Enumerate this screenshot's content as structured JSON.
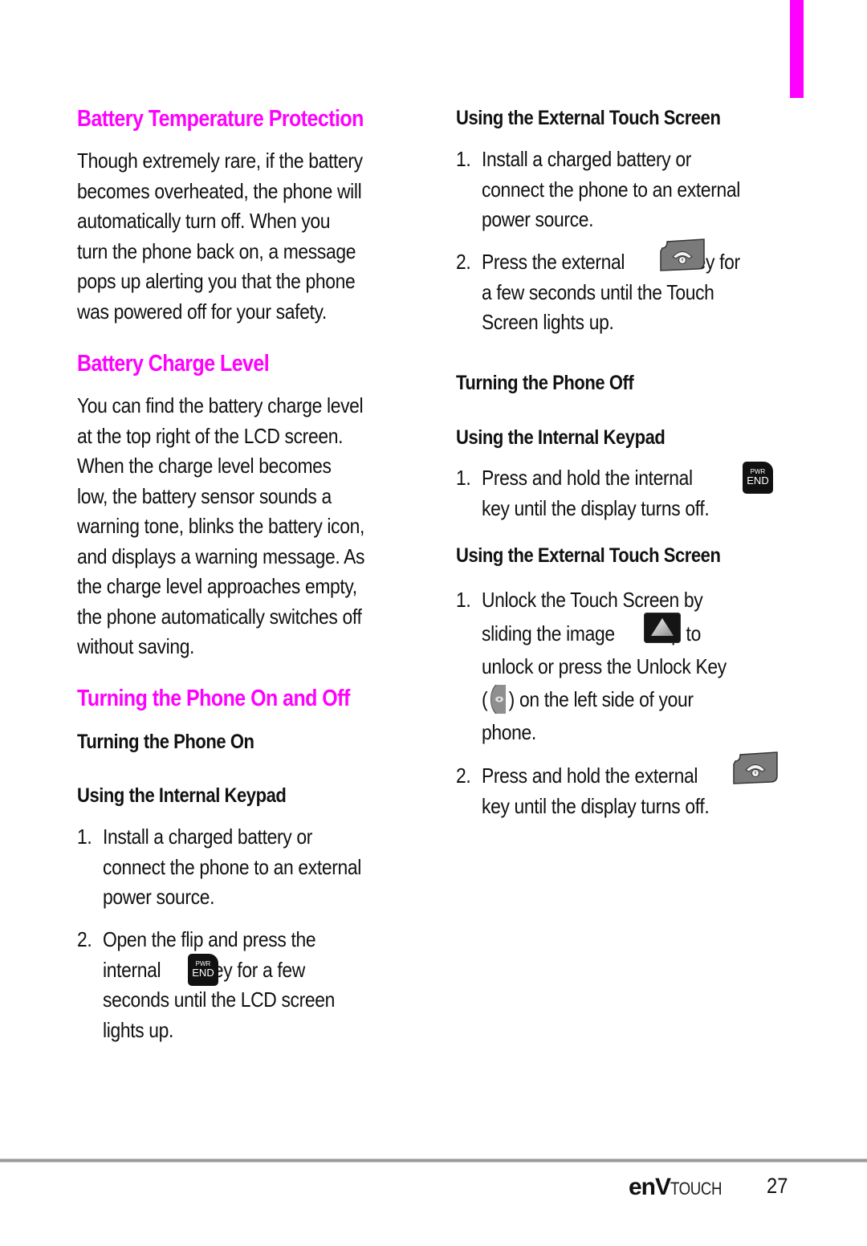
{
  "colors": {
    "accent": "#FF00FF",
    "text": "#111111",
    "rule": "#999999"
  },
  "left": {
    "battery_temp": {
      "heading": "Battery Temperature Protection",
      "lines": [
        "Though extremely rare, if the battery",
        "becomes overheated, the phone will",
        "automatically turn off. When you",
        "turn the phone back on, a message",
        "pops up alerting you that the phone",
        "was powered off for your safety."
      ]
    },
    "battery_charge": {
      "heading": "Battery Charge Level",
      "lines": [
        "You can find the battery charge level",
        "at the top right of the LCD screen.",
        "When the charge level becomes",
        "low, the battery sensor sounds a",
        "warning tone, blinks the battery icon,",
        "and displays a warning message. As",
        "the charge level approaches empty,",
        "the phone automatically switches off",
        "without saving."
      ]
    },
    "on_off": {
      "heading": "Turning the Phone On and Off",
      "subheading_on": "Turning the Phone On",
      "internal_keypad_heading": "Using the Internal Keypad",
      "steps": [
        {
          "number": "1.",
          "lines": [
            "Install a charged battery or",
            "connect the phone to an external",
            "power source."
          ]
        },
        {
          "number": "2.",
          "line1": "Open the flip and press the",
          "line2_before": "internal",
          "line2_after": "key for a few",
          "line3": "seconds until the LCD screen",
          "line4": "lights up.",
          "icon": "pwr-end-key-icon"
        }
      ]
    }
  },
  "right": {
    "external_on": {
      "heading": "Using the External Touch Screen",
      "steps": [
        {
          "number": "1.",
          "lines": [
            "Install a charged battery or",
            "connect the phone to an external",
            "power source."
          ]
        },
        {
          "number": "2.",
          "line1_before": "Press the external",
          "line1_after": "key for",
          "line2": "a few seconds until the Touch",
          "line3": "Screen lights up.",
          "icon": "external-end-key-icon"
        }
      ]
    },
    "turning_off": {
      "heading": "Turning the Phone Off",
      "internal_keypad_heading": "Using the Internal Keypad",
      "step": {
        "number": "1.",
        "line1_before": "Press and hold the internal",
        "line2": "key until the display turns off.",
        "icon": "pwr-end-key-icon"
      }
    },
    "external_off": {
      "heading": "Using the External Touch Screen",
      "steps": [
        {
          "number": "1.",
          "line1": "Unlock the Touch Screen by",
          "line2_before": "sliding the image",
          "line2_after": "up to",
          "line3": "unlock or press the Unlock Key",
          "line4_open": "(",
          "line4_after": ") on the left side of your",
          "line5": "phone.",
          "icons": [
            "slide-up-arrow-icon",
            "unlock-key-icon"
          ]
        },
        {
          "number": "2.",
          "line1_before": "Press and hold the external",
          "line2": "key until the display turns off.",
          "icon": "external-end-key-icon"
        }
      ]
    }
  },
  "pwr_end_key": {
    "top_label": "PWR",
    "bottom_label": "END"
  },
  "footer": {
    "brand_bold": "enV",
    "brand_light": "TOUCH",
    "page_number": "27"
  }
}
